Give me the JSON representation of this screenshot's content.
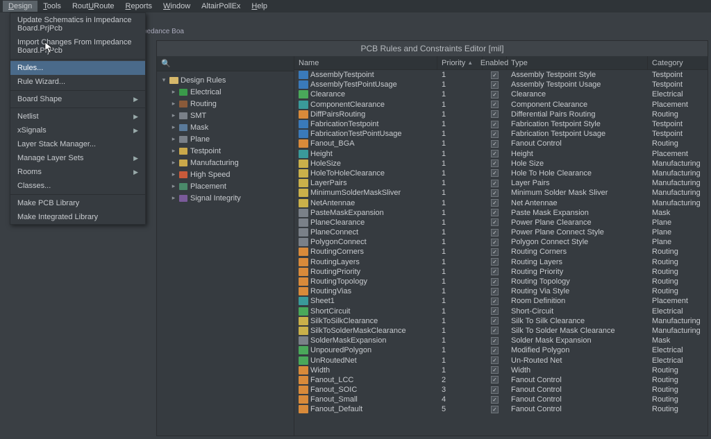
{
  "menubar": [
    {
      "label": "Design",
      "hotkey": "D",
      "active": true
    },
    {
      "label": "Tools",
      "hotkey": "T"
    },
    {
      "label": "Route",
      "hotkey": "U"
    },
    {
      "label": "Reports",
      "hotkey": "R"
    },
    {
      "label": "Window",
      "hotkey": "W"
    },
    {
      "label": "AltairPollEx"
    },
    {
      "label": "Help",
      "hotkey": "H"
    }
  ],
  "dropdown": [
    {
      "label": "Update Schematics in Impedance Board.PrjPcb",
      "type": "item"
    },
    {
      "label": "Import Changes From Impedance Board.PrjPcb",
      "type": "item"
    },
    {
      "type": "sep"
    },
    {
      "label": "Rules...",
      "type": "item",
      "highlight": true
    },
    {
      "label": "Rule Wizard...",
      "type": "item"
    },
    {
      "type": "sep"
    },
    {
      "label": "Board Shape",
      "type": "sub"
    },
    {
      "type": "sep"
    },
    {
      "label": "Netlist",
      "type": "sub"
    },
    {
      "label": "xSignals",
      "type": "sub"
    },
    {
      "label": "Layer Stack Manager...",
      "type": "item"
    },
    {
      "label": "Manage Layer Sets",
      "type": "sub"
    },
    {
      "label": "Rooms",
      "type": "sub"
    },
    {
      "label": "Classes...",
      "type": "item"
    },
    {
      "type": "sep"
    },
    {
      "label": "Make PCB Library",
      "type": "item"
    },
    {
      "label": "Make Integrated Library",
      "type": "item"
    }
  ],
  "underbar_hint": "pedance Boa",
  "editor": {
    "title": "PCB Rules and Constraints Editor [mil]",
    "search_placeholder": "",
    "tree": {
      "root_label": "Design Rules",
      "children": [
        {
          "label": "Electrical",
          "icon": "ico-e"
        },
        {
          "label": "Routing",
          "icon": "ico-rt"
        },
        {
          "label": "SMT",
          "icon": "ico-box"
        },
        {
          "label": "Mask",
          "icon": "ico-m"
        },
        {
          "label": "Plane",
          "icon": "ico-box"
        },
        {
          "label": "Testpoint",
          "icon": "ico-fl"
        },
        {
          "label": "Manufacturing",
          "icon": "ico-fl"
        },
        {
          "label": "High Speed",
          "icon": "ico-hs"
        },
        {
          "label": "Placement",
          "icon": "ico-p"
        },
        {
          "label": "Signal Integrity",
          "icon": "ico-si"
        }
      ]
    },
    "columns": {
      "name": "Name",
      "priority": "Priority",
      "enabled": "Enabled",
      "type": "Type",
      "category": "Category"
    },
    "rows": [
      {
        "icon": "c-blue",
        "name": "AssemblyTestpoint",
        "prio": "1",
        "en": true,
        "type": "Assembly Testpoint Style",
        "cat": "Testpoint"
      },
      {
        "icon": "c-blue",
        "name": "AssemblyTestPointUsage",
        "prio": "1",
        "en": true,
        "type": "Assembly Testpoint Usage",
        "cat": "Testpoint"
      },
      {
        "icon": "c-green",
        "name": "Clearance",
        "prio": "1",
        "en": true,
        "type": "Clearance",
        "cat": "Electrical"
      },
      {
        "icon": "c-teal",
        "name": "ComponentClearance",
        "prio": "1",
        "en": true,
        "type": "Component Clearance",
        "cat": "Placement"
      },
      {
        "icon": "c-orange",
        "name": "DiffPairsRouting",
        "prio": "1",
        "en": true,
        "type": "Differential Pairs Routing",
        "cat": "Routing"
      },
      {
        "icon": "c-blue",
        "name": "FabricationTestpoint",
        "prio": "1",
        "en": true,
        "type": "Fabrication Testpoint Style",
        "cat": "Testpoint"
      },
      {
        "icon": "c-blue",
        "name": "FabricationTestPointUsage",
        "prio": "1",
        "en": true,
        "type": "Fabrication Testpoint Usage",
        "cat": "Testpoint"
      },
      {
        "icon": "c-orange",
        "name": "Fanout_BGA",
        "prio": "1",
        "en": true,
        "type": "Fanout Control",
        "cat": "Routing"
      },
      {
        "icon": "c-teal",
        "name": "Height",
        "prio": "1",
        "en": true,
        "type": "Height",
        "cat": "Placement"
      },
      {
        "icon": "c-yellow",
        "name": "HoleSize",
        "prio": "1",
        "en": true,
        "type": "Hole Size",
        "cat": "Manufacturing"
      },
      {
        "icon": "c-yellow",
        "name": "HoleToHoleClearance",
        "prio": "1",
        "en": true,
        "type": "Hole To Hole Clearance",
        "cat": "Manufacturing"
      },
      {
        "icon": "c-yellow",
        "name": "LayerPairs",
        "prio": "1",
        "en": true,
        "type": "Layer Pairs",
        "cat": "Manufacturing"
      },
      {
        "icon": "c-yellow",
        "name": "MinimumSolderMaskSliver",
        "prio": "1",
        "en": true,
        "type": "Minimum Solder Mask Sliver",
        "cat": "Manufacturing"
      },
      {
        "icon": "c-yellow",
        "name": "NetAntennae",
        "prio": "1",
        "en": true,
        "type": "Net Antennae",
        "cat": "Manufacturing"
      },
      {
        "icon": "c-grey",
        "name": "PasteMaskExpansion",
        "prio": "1",
        "en": true,
        "type": "Paste Mask Expansion",
        "cat": "Mask"
      },
      {
        "icon": "c-grey",
        "name": "PlaneClearance",
        "prio": "1",
        "en": true,
        "type": "Power Plane Clearance",
        "cat": "Plane"
      },
      {
        "icon": "c-grey",
        "name": "PlaneConnect",
        "prio": "1",
        "en": true,
        "type": "Power Plane Connect Style",
        "cat": "Plane"
      },
      {
        "icon": "c-grey",
        "name": "PolygonConnect",
        "prio": "1",
        "en": true,
        "type": "Polygon Connect Style",
        "cat": "Plane"
      },
      {
        "icon": "c-orange",
        "name": "RoutingCorners",
        "prio": "1",
        "en": true,
        "type": "Routing Corners",
        "cat": "Routing"
      },
      {
        "icon": "c-orange",
        "name": "RoutingLayers",
        "prio": "1",
        "en": true,
        "type": "Routing Layers",
        "cat": "Routing"
      },
      {
        "icon": "c-orange",
        "name": "RoutingPriority",
        "prio": "1",
        "en": true,
        "type": "Routing Priority",
        "cat": "Routing"
      },
      {
        "icon": "c-orange",
        "name": "RoutingTopology",
        "prio": "1",
        "en": true,
        "type": "Routing Topology",
        "cat": "Routing"
      },
      {
        "icon": "c-orange",
        "name": "RoutingVias",
        "prio": "1",
        "en": true,
        "type": "Routing Via Style",
        "cat": "Routing"
      },
      {
        "icon": "c-teal",
        "name": "Sheet1",
        "prio": "1",
        "en": true,
        "type": "Room Definition",
        "cat": "Placement"
      },
      {
        "icon": "c-green",
        "name": "ShortCircuit",
        "prio": "1",
        "en": true,
        "type": "Short-Circuit",
        "cat": "Electrical"
      },
      {
        "icon": "c-yellow",
        "name": "SilkToSilkClearance",
        "prio": "1",
        "en": true,
        "type": "Silk To Silk Clearance",
        "cat": "Manufacturing"
      },
      {
        "icon": "c-yellow",
        "name": "SilkToSolderMaskClearance",
        "prio": "1",
        "en": true,
        "type": "Silk To Solder Mask Clearance",
        "cat": "Manufacturing"
      },
      {
        "icon": "c-grey",
        "name": "SolderMaskExpansion",
        "prio": "1",
        "en": true,
        "type": "Solder Mask Expansion",
        "cat": "Mask"
      },
      {
        "icon": "c-green",
        "name": "UnpouredPolygon",
        "prio": "1",
        "en": true,
        "type": "Modified Polygon",
        "cat": "Electrical"
      },
      {
        "icon": "c-green",
        "name": "UnRoutedNet",
        "prio": "1",
        "en": true,
        "type": "Un-Routed Net",
        "cat": "Electrical"
      },
      {
        "icon": "c-orange",
        "name": "Width",
        "prio": "1",
        "en": true,
        "type": "Width",
        "cat": "Routing"
      },
      {
        "icon": "c-orange",
        "name": "Fanout_LCC",
        "prio": "2",
        "en": true,
        "type": "Fanout Control",
        "cat": "Routing"
      },
      {
        "icon": "c-orange",
        "name": "Fanout_SOIC",
        "prio": "3",
        "en": true,
        "type": "Fanout Control",
        "cat": "Routing"
      },
      {
        "icon": "c-orange",
        "name": "Fanout_Small",
        "prio": "4",
        "en": true,
        "type": "Fanout Control",
        "cat": "Routing"
      },
      {
        "icon": "c-orange",
        "name": "Fanout_Default",
        "prio": "5",
        "en": true,
        "type": "Fanout Control",
        "cat": "Routing"
      }
    ]
  }
}
